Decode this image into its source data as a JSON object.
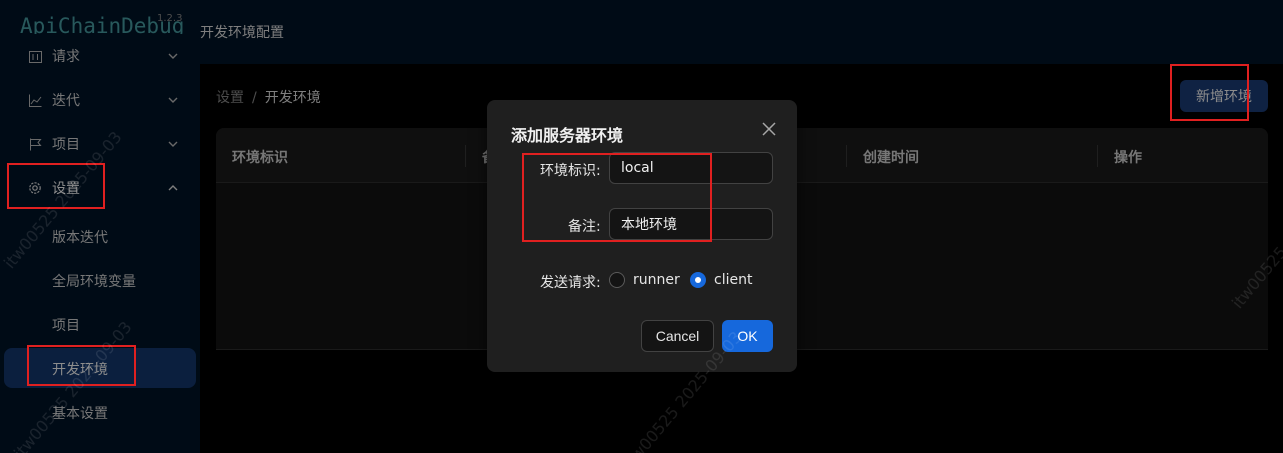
{
  "app": {
    "logo_text": "ApiChainDebug",
    "version": "1.2.3",
    "header_title": "开发环境配置"
  },
  "sidebar": {
    "items": [
      {
        "label": "请求",
        "icon": "calendar-icon"
      },
      {
        "label": "迭代",
        "icon": "line-chart-icon"
      },
      {
        "label": "项目",
        "icon": "flag-icon"
      },
      {
        "label": "设置",
        "icon": "gear-icon"
      }
    ],
    "settings_children": [
      {
        "label": "版本迭代"
      },
      {
        "label": "全局环境变量"
      },
      {
        "label": "项目"
      },
      {
        "label": "开发环境"
      },
      {
        "label": "基本设置"
      }
    ]
  },
  "breadcrumb": {
    "parent": "设置",
    "separator": "/",
    "current": "开发环境"
  },
  "toolbar": {
    "add_env_label": "新增环境"
  },
  "table": {
    "columns": [
      "环境标识",
      "备注",
      "",
      "创建时间",
      "操作"
    ]
  },
  "modal": {
    "title": "添加服务器环境",
    "env_id_label": "环境标识:",
    "env_id_value": "local",
    "remark_label": "备注:",
    "remark_value": "本地环境",
    "send_label": "发送请求:",
    "radio_options": [
      {
        "label": "runner",
        "checked": false
      },
      {
        "label": "client",
        "checked": true
      }
    ],
    "cancel_label": "Cancel",
    "ok_label": "OK"
  },
  "watermark": {
    "text": "itw00525 2025-09-03"
  },
  "colors": {
    "accent": "#1668dc",
    "selected_menu_bg": "#153a72",
    "annotation_red": "#e02020",
    "sidebar_bg": "#001529"
  }
}
